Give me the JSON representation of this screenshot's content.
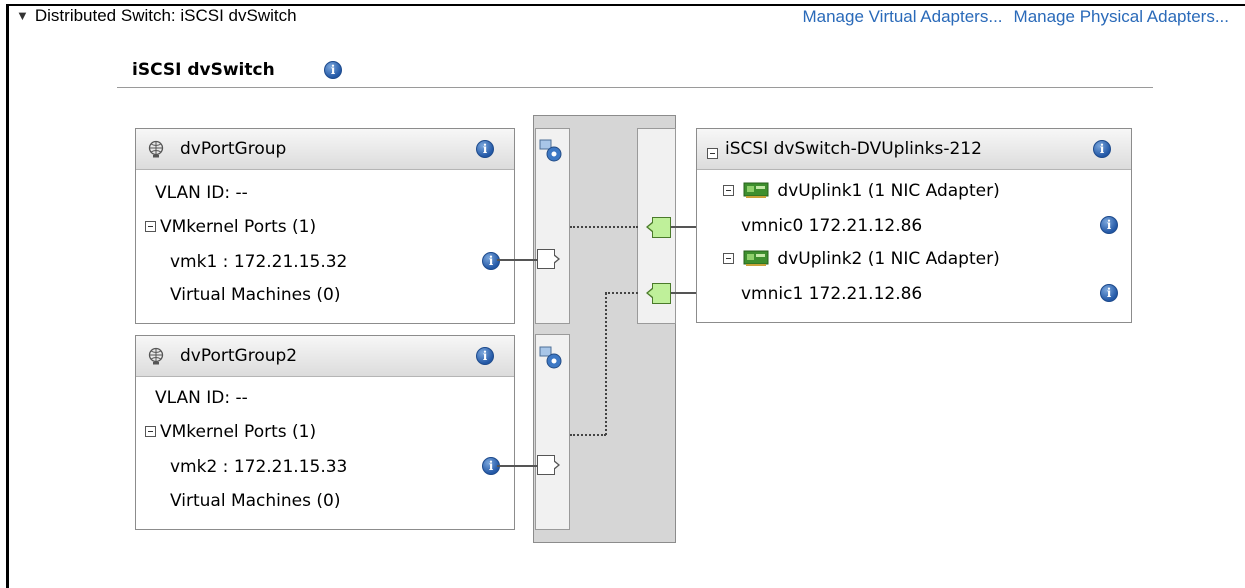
{
  "header": {
    "section_title": "Distributed Switch: iSCSI dvSwitch",
    "links": [
      "Manage Virtual Adapters...",
      "Manage Physical Adapters..."
    ]
  },
  "switch": {
    "name": "iSCSI dvSwitch"
  },
  "port_groups": [
    {
      "name": "dvPortGroup",
      "vlan": "VLAN ID: --",
      "vmkernel_ports": "VMkernel Ports (1)",
      "vmk": "vmk1 : 172.21.15.32",
      "vms": "Virtual Machines (0)"
    },
    {
      "name": "dvPortGroup2",
      "vlan": "VLAN ID: --",
      "vmkernel_ports": "VMkernel Ports (1)",
      "vmk": "vmk2 : 172.21.15.33",
      "vms": "Virtual Machines (0)"
    }
  ],
  "uplinks": {
    "name": "iSCSI dvSwitch-DVUplinks-212",
    "items": [
      {
        "label": "dvUplink1 (1 NIC Adapter)",
        "nic": "vmnic0 172.21.12.86"
      },
      {
        "label": "dvUplink2 (1 NIC Adapter)",
        "nic": "vmnic1 172.21.12.86"
      }
    ]
  },
  "colors": {
    "link": "#2a6ab9",
    "uplink_port": "#bff09a",
    "info_icon": "#2358a6"
  },
  "icons": {
    "collapse": "triangle-down-icon",
    "info": "info-icon",
    "port_group": "port-group-icon",
    "uplink_nic": "nic-adapter-icon",
    "dvs_port": "dvs-port-icon"
  }
}
